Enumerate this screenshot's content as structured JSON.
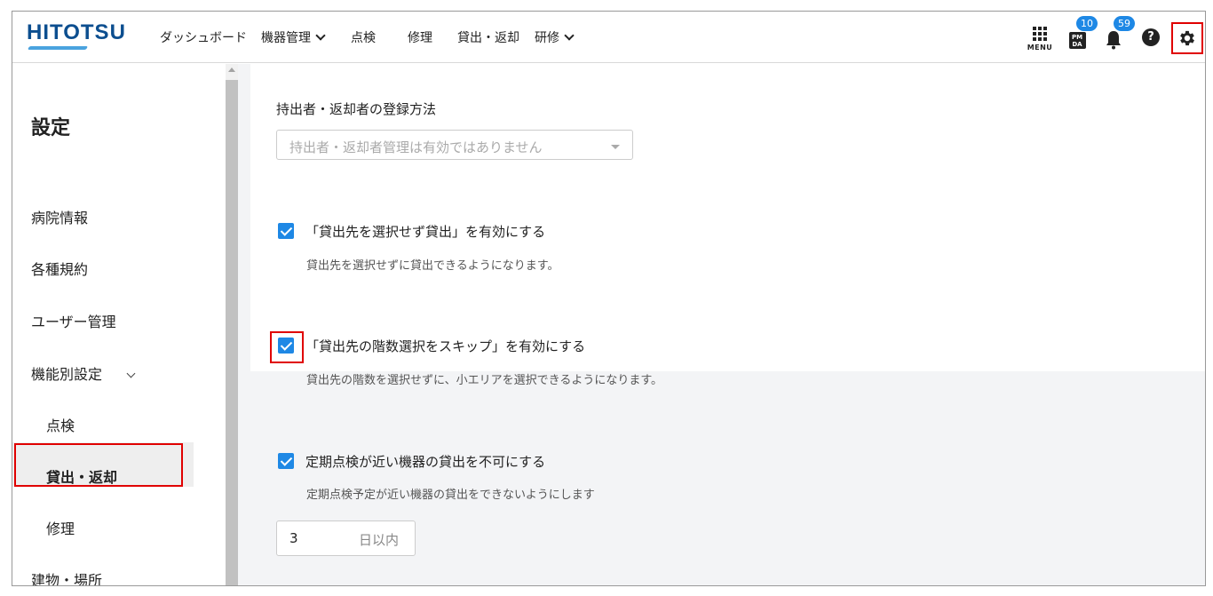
{
  "header": {
    "logo": "HITOTSU",
    "nav": [
      {
        "label": "ダッシュボード",
        "dropdown": false
      },
      {
        "label": "機器管理",
        "dropdown": true
      },
      {
        "label": "点検",
        "dropdown": false
      },
      {
        "label": "修理",
        "dropdown": false
      },
      {
        "label": "貸出・返却",
        "dropdown": false
      },
      {
        "label": "研修",
        "dropdown": true
      }
    ],
    "menu_label": "MENU",
    "pmda_label": "PM DA",
    "pmda_badge": "10",
    "bell_badge": "59",
    "help_glyph": "?"
  },
  "sidebar": {
    "title": "設定",
    "items": {
      "hospital": "病院情報",
      "rules": "各種規約",
      "users": "ユーザー管理",
      "features": "機能別設定",
      "inspection": "点検",
      "lending": "貸出・返却",
      "repair": "修理",
      "buildings": "建物・場所"
    },
    "active": "貸出・返却"
  },
  "main": {
    "registration": {
      "label": "持出者・返却者の登録方法",
      "select_value": "持出者・返却者管理は有効ではありません"
    },
    "options": [
      {
        "label": "「貸出先を選択せず貸出」を有効にする",
        "desc": "貸出先を選択せずに貸出できるようになります。",
        "checked": true
      },
      {
        "label": "「貸出先の階数選択をスキップ」を有効にする",
        "desc": "貸出先の階数を選択せずに、小エリアを選択できるようになります。",
        "checked": true
      },
      {
        "label": "定期点検が近い機器の貸出を不可にする",
        "desc": "定期点検予定が近い機器の貸出をできないようにします",
        "checked": true
      }
    ],
    "days": {
      "value": "3",
      "unit": "日以内"
    }
  },
  "colors": {
    "accent": "#1e88e5",
    "brand": "#0c4e8f",
    "highlight": "#e00000"
  }
}
